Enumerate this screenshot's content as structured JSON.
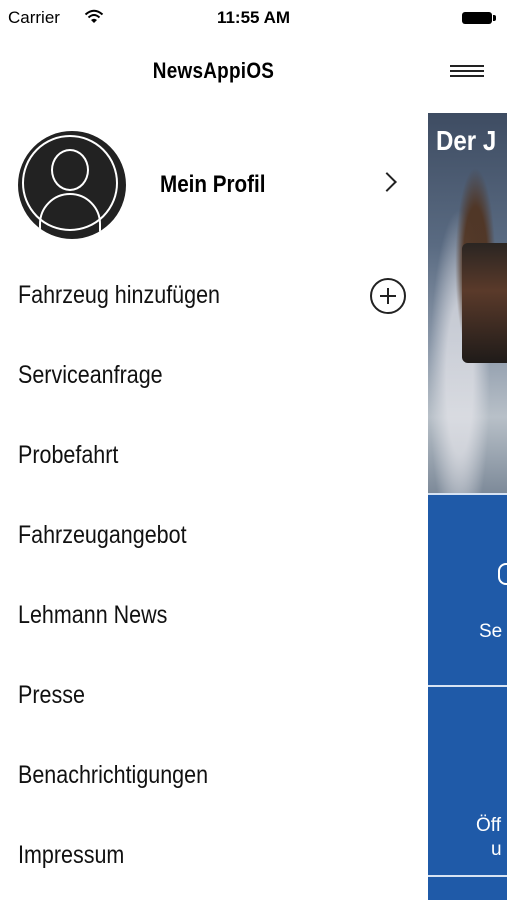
{
  "status_bar": {
    "carrier": "Carrier",
    "time": "11:55 AM"
  },
  "nav": {
    "title": "NewsAppiOS"
  },
  "profile": {
    "label": "Mein Profil"
  },
  "menu": {
    "items": [
      {
        "label": "Fahrzeug hinzufügen",
        "icon": "plus-circle-icon"
      },
      {
        "label": "Serviceanfrage"
      },
      {
        "label": "Probefahrt"
      },
      {
        "label": "Fahrzeugangebot"
      },
      {
        "label": "Lehmann News"
      },
      {
        "label": "Presse"
      },
      {
        "label": "Benachrichtigungen"
      },
      {
        "label": "Impressum"
      }
    ]
  },
  "content": {
    "hero_title": "Der J",
    "tile1_label": "Se",
    "tile2_label1": "Öff",
    "tile2_label2": "u"
  },
  "colors": {
    "tile_blue": "#1f5aa8",
    "background": "#ffffff"
  }
}
